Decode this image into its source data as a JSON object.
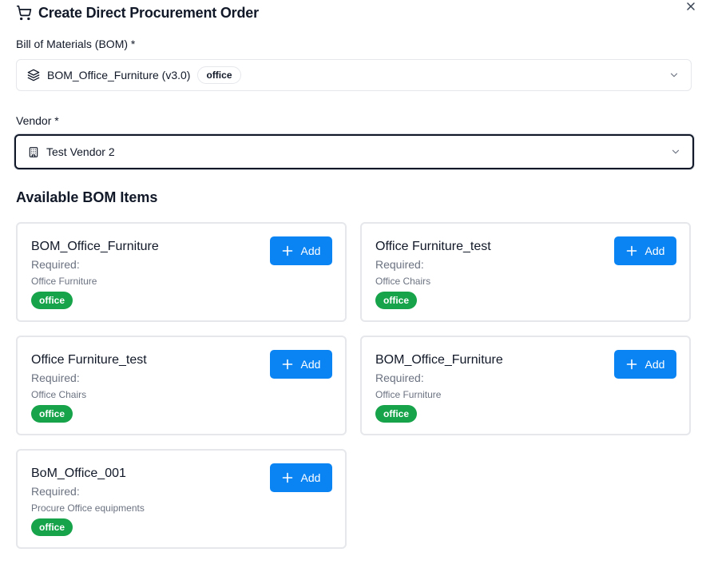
{
  "dialog": {
    "title": "Create Direct Procurement Order",
    "icons": {
      "title": "shopping-cart-icon",
      "close": "close-icon"
    }
  },
  "bom_field": {
    "label": "Bill of Materials (BOM) *",
    "value": "BOM_Office_Furniture (v3.0)",
    "tag": "office",
    "icon": "layers-icon"
  },
  "vendor_field": {
    "label": "Vendor *",
    "value": "Test Vendor 2",
    "icon": "building-icon"
  },
  "section": {
    "title": "Available BOM Items"
  },
  "items": [
    {
      "name": "BOM_Office_Furniture",
      "required": "Required:",
      "category": "Office Furniture",
      "tag": "office",
      "add_label": "Add"
    },
    {
      "name": "Office Furniture_test",
      "required": "Required:",
      "category": "Office Chairs",
      "tag": "office",
      "add_label": "Add"
    },
    {
      "name": "Office Furniture_test",
      "required": "Required:",
      "category": "Office Chairs",
      "tag": "office",
      "add_label": "Add"
    },
    {
      "name": "BOM_Office_Furniture",
      "required": "Required:",
      "category": "Office Furniture",
      "tag": "office",
      "add_label": "Add"
    },
    {
      "name": "BoM_Office_001",
      "required": "Required:",
      "category": "Procure Office equipments",
      "tag": "office",
      "add_label": "Add"
    }
  ],
  "colors": {
    "primary": "#0b84f3",
    "tag_green": "#16a34a",
    "border": "#e5e7eb",
    "focus": "#111827"
  }
}
